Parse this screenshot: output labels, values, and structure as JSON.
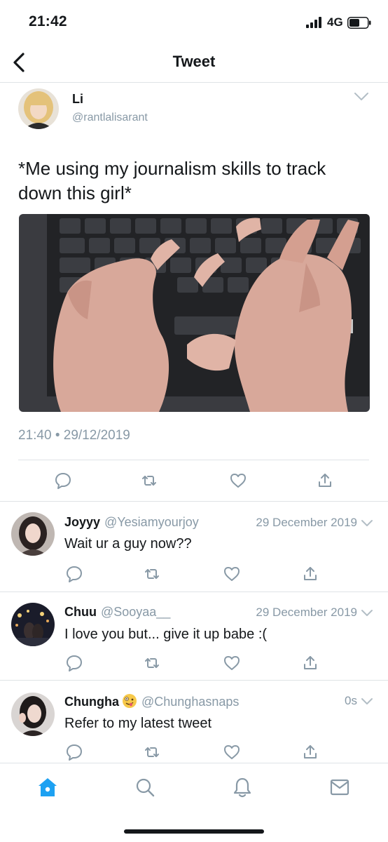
{
  "status_bar": {
    "time": "21:42",
    "network": "4G"
  },
  "header": {
    "title": "Tweet"
  },
  "tweet": {
    "name": "Li",
    "handle": "@rantlalisarant",
    "text": "*Me using my journalism skills to track down this girl*",
    "timestamp": "21:40 • 29/12/2019"
  },
  "replies": [
    {
      "name": "Joyyy",
      "handle": "@Yesiamyourjoy",
      "date": "29 December 2019",
      "text": "Wait ur a guy now??"
    },
    {
      "name": "Chuu",
      "handle": "@Sooyaa__",
      "date": "29 December 2019",
      "text": "I love you but... give it up babe :("
    },
    {
      "name": "Chungha",
      "emoji": "zany-face-emoji",
      "handle": "@Chunghasnaps",
      "date": "0s",
      "text": "Refer to my latest tweet"
    }
  ],
  "tab_bar": {
    "items": [
      "home-icon",
      "search-icon",
      "notifications-icon",
      "messages-icon"
    ],
    "active": "home-icon"
  },
  "colors": {
    "accent": "#1da1f2",
    "secondary_text": "#8899a6",
    "divider": "#dfe3e6",
    "icon": "#8899a6"
  }
}
